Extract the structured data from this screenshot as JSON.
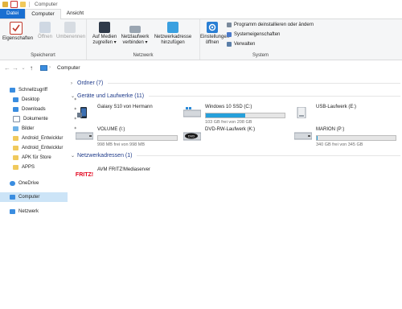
{
  "window": {
    "title": "Computer"
  },
  "tabs": [
    {
      "label": "Datei"
    },
    {
      "label": "Computer"
    },
    {
      "label": "Ansicht"
    }
  ],
  "ribbon": {
    "storage": {
      "label": "Speicherort",
      "buttons": [
        {
          "label": "Eigenschaften"
        },
        {
          "label": "Öffnen"
        },
        {
          "label": "Umbenennen"
        }
      ]
    },
    "network": {
      "label": "Netzwerk",
      "buttons": [
        {
          "label1": "Auf Medien",
          "label2": "zugreifen ▾"
        },
        {
          "label1": "Netzlaufwerk",
          "label2": "verbinden ▾"
        },
        {
          "label1": "Netzwerkadresse",
          "label2": "hinzufügen"
        }
      ]
    },
    "system": {
      "label": "System",
      "settings": {
        "label1": "Einstellungen",
        "label2": "öffnen"
      },
      "items": [
        {
          "label": "Programm deinstallieren oder ändern"
        },
        {
          "label": "Systemeigenschaften"
        },
        {
          "label": "Verwalten"
        }
      ]
    }
  },
  "address": {
    "path": "Computer"
  },
  "sidebar": [
    {
      "label": "Schnellzugriff"
    },
    {
      "label": "Desktop"
    },
    {
      "label": "Downloads"
    },
    {
      "label": "Dokumente"
    },
    {
      "label": "Bilder"
    },
    {
      "label": "Android_Entwicklur"
    },
    {
      "label": "Android_Entwicklur"
    },
    {
      "label": "APK für Store"
    },
    {
      "label": "APPS"
    },
    {
      "label": "OneDrive"
    },
    {
      "label": "Computer"
    },
    {
      "label": "Netzwerk"
    }
  ],
  "sections": {
    "folders": "Ordner (7)",
    "devices": "Geräte und Laufwerke (11)",
    "network": "Netzwerkadressen (1)"
  },
  "drives": [
    {
      "name": "Galaxy S10 von Hermann",
      "free": ""
    },
    {
      "name": "Windows 10 SSD (C:)",
      "free": "103 GB frei von 208 GB",
      "used_fraction": 0.5
    },
    {
      "name": "USB-Laufwerk (E:)",
      "free": ""
    },
    {
      "name": "VOLUME (I:)",
      "free": "998 MB frei von 998 MB",
      "used_fraction": 0.0
    },
    {
      "name": "DVD-RW-Laufwerk (K:)",
      "free": ""
    },
    {
      "name": "MARION (P:)",
      "free": "340 GB frei von 345 GB",
      "used_fraction": 0.015
    }
  ],
  "network_items": [
    {
      "name": "AVM FRITZ!Mediaserver"
    }
  ]
}
